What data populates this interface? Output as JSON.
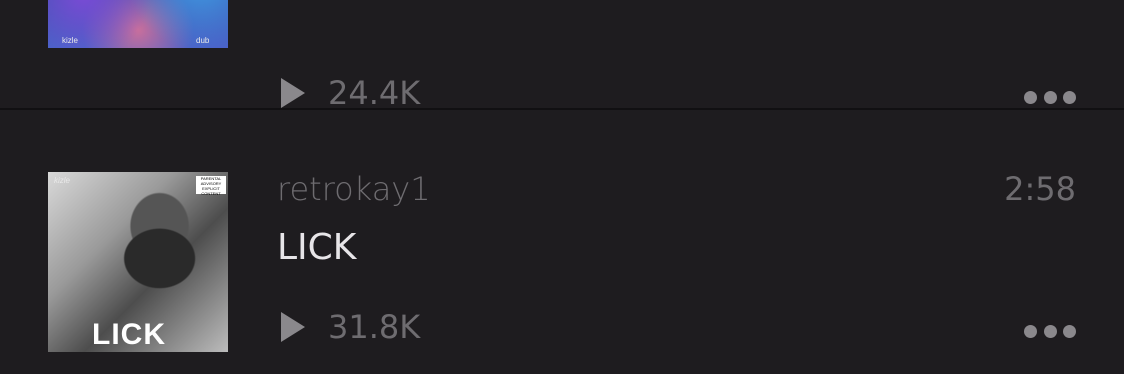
{
  "tracks": [
    {
      "plays": "24.4K",
      "artwork_text": {
        "left": "kizle",
        "right": "dub"
      }
    },
    {
      "user": "retrokay1",
      "title": "LICK",
      "duration": "2:58",
      "plays": "31.8K",
      "artwork_text": {
        "artist": "kizle",
        "title": "LICK",
        "advisory": "PARENTAL ADVISORY EXPLICIT CONTENT"
      }
    }
  ],
  "icons": {
    "play": "play-icon",
    "more": "more-icon"
  },
  "colors": {
    "background": "#1e1c1f",
    "primary_text": "#e7e5e8",
    "secondary_text": "#6e6c70",
    "icon": "#8a888c"
  }
}
